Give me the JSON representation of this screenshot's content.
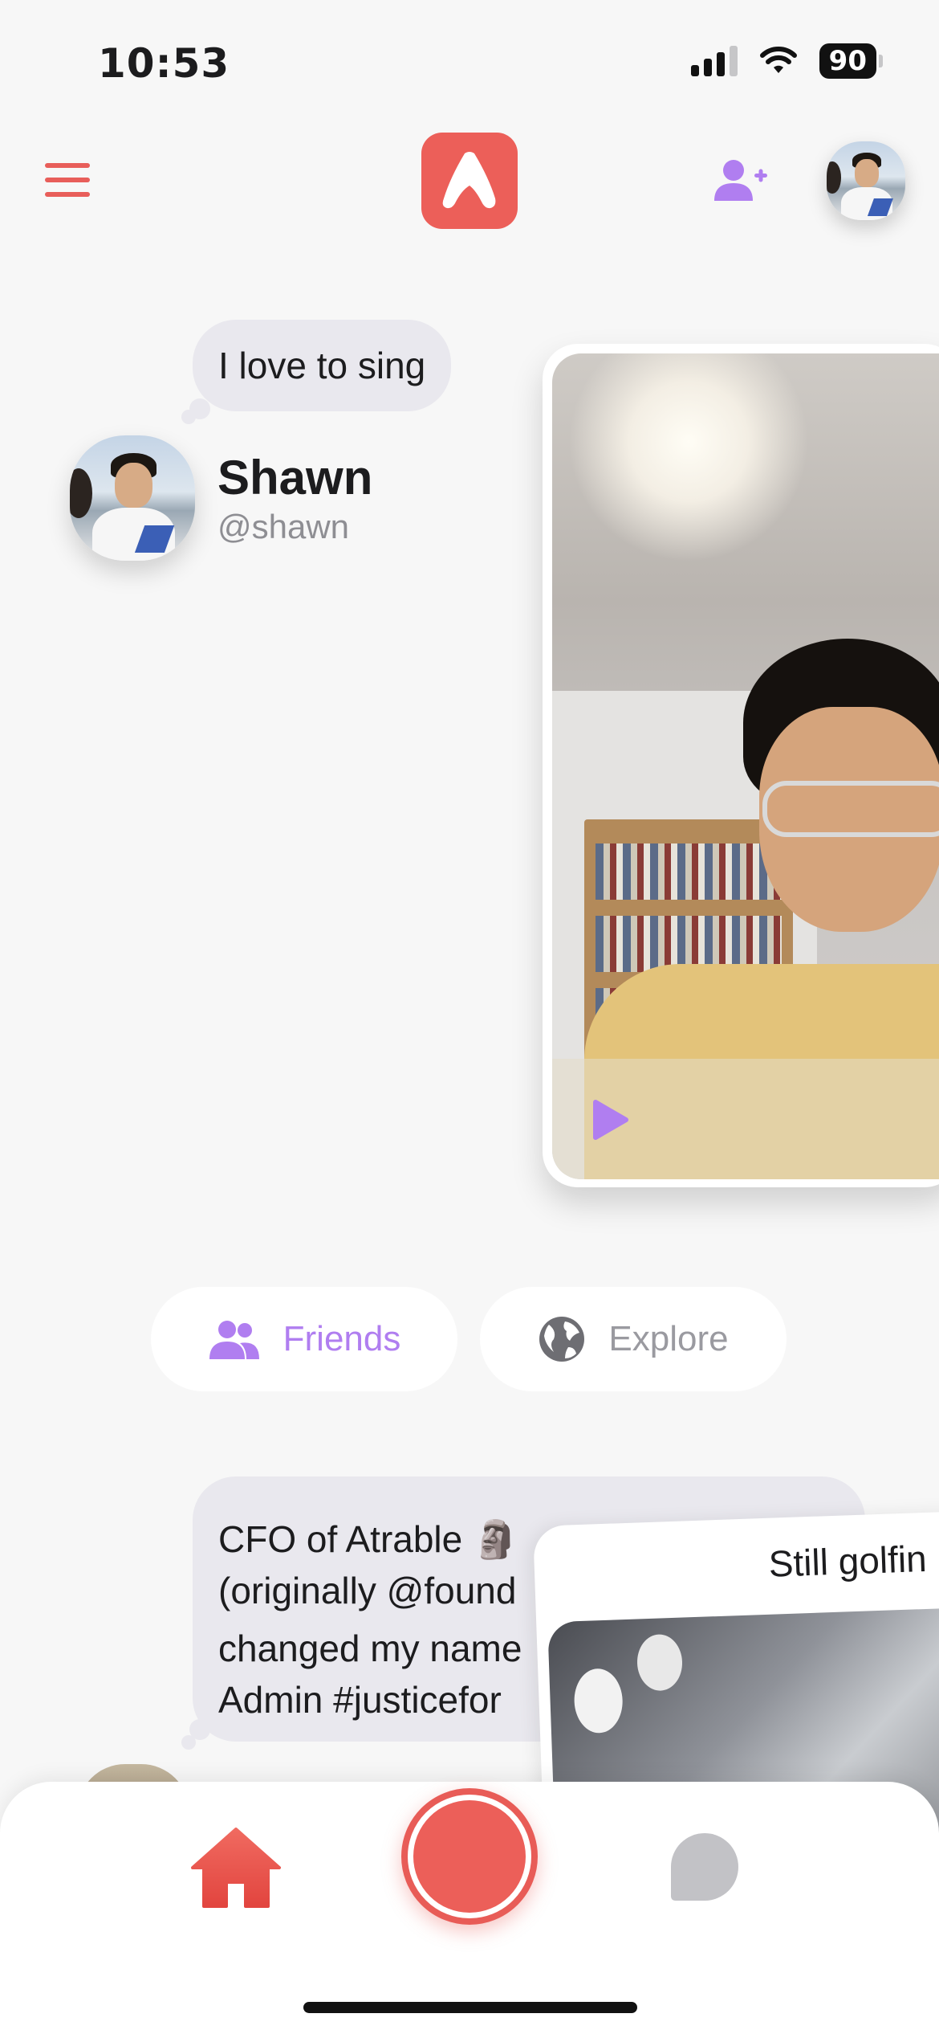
{
  "status_bar": {
    "time": "10:53",
    "battery": "90"
  },
  "profile_1": {
    "status_bubble": "I love to sing",
    "name": "Shawn",
    "handle": "@shawn"
  },
  "tabs": [
    {
      "label": "Friends"
    },
    {
      "label": "Explore"
    }
  ],
  "profile_2": {
    "status_lines": [
      "CFO of Atrable 🗿",
      "(originally @found",
      "changed my name",
      "Admin #justicefor"
    ],
    "card_caption": "Still golfin"
  },
  "colors": {
    "brand": "#ec5f59",
    "accent": "#b07ef0",
    "muted": "#9a9aa0",
    "background": "#f7f7f7"
  },
  "icons": {
    "menu": "hamburger-icon",
    "logo": "app-logo-icon",
    "add_friend": "add-friend-icon",
    "friends": "people-icon",
    "explore": "globe-icon",
    "play": "play-icon",
    "home": "home-icon",
    "record": "record-icon",
    "chat": "chat-bubble-icon"
  }
}
